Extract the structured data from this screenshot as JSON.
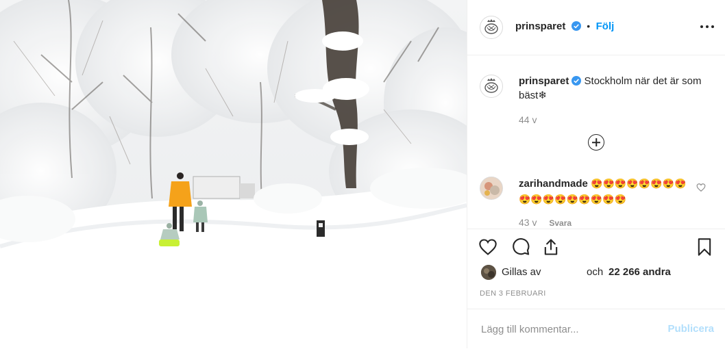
{
  "post": {
    "image_description_icon": "snowy-park-photo-icon"
  },
  "header": {
    "username": "prinsparet",
    "separator": "•",
    "follow_label": "Följ",
    "more_icon": "more-options-icon"
  },
  "caption": {
    "username": "prinsparet",
    "text": "Stockholm när det är som bäst❄",
    "age": "44 v"
  },
  "comments": [
    {
      "username": "zarihandmade",
      "text": "😍😍😍😍😍😍😍😍😍😍😍😍😍😍😍😍😍",
      "age": "43 v",
      "reply_label": "Svara"
    }
  ],
  "actions": {
    "like_icon": "heart-icon",
    "comment_icon": "comment-bubble-icon",
    "share_icon": "share-icon",
    "save_icon": "bookmark-icon"
  },
  "likes": {
    "prefix": "Gillas av",
    "suffix_and": "och",
    "count": "22 266 andra"
  },
  "date": "DEN 3 FEBRUARI",
  "composer": {
    "placeholder": "Lägg till kommentar...",
    "publish_label": "Publicera"
  },
  "colors": {
    "link_blue": "#0095f6",
    "publish_disabled": "#b2dffc",
    "verified_blue": "#3897f0",
    "jacket_orange": "#f5a21a"
  }
}
